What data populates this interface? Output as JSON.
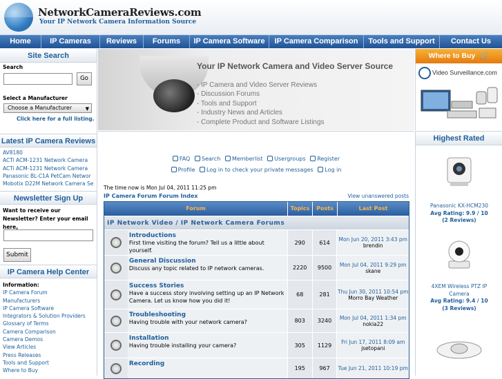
{
  "header": {
    "site_name": "NetworkCameraReviews.com",
    "tagline": "Your IP Network Camera Information Source"
  },
  "nav": {
    "items": [
      "Home",
      "IP Cameras",
      "Reviews",
      "Forums",
      "IP Camera Software",
      "IP Camera Comparison",
      "Tools and Support",
      "Contact Us"
    ]
  },
  "left": {
    "site_search": {
      "heading": "Site Search",
      "search_label": "Search",
      "go_label": "Go",
      "manufacturer_label": "Select a Manufacturer",
      "manufacturer_selected": "Choose a Manufacturer",
      "full_listing_link": "Click here for a full listing."
    },
    "latest_reviews": {
      "heading": "Latest IP Camera Reviews",
      "items": [
        "AV8180",
        "ACTi ACM-1231 Network Camera",
        "ACTi ACM-1231 Network Camera",
        "Panasonic BL-C1A PetCam Networ",
        "Mobotix D22M Network Camera Se"
      ]
    },
    "newsletter": {
      "heading": "Newsletter Sign Up",
      "prompt": "Want to receive our Newsletter? Enter your email here,",
      "submit_label": "Submit"
    },
    "help_center": {
      "heading": "IP Camera Help Center",
      "info_label": "Information:",
      "items": [
        "IP Camera Forum",
        "Manufacturers",
        "IP Camera Software",
        "Integrators & Solution Providers",
        "Glossary of Terms",
        "Camera Comparison",
        "Camera Demos",
        "View Articles",
        "Press Releases",
        "Tools and Support",
        "Where to Buy"
      ]
    }
  },
  "banner": {
    "title": "Your IP Network Camera and Video Server Source",
    "bullets": [
      "- IP Camera and Video Server Reviews",
      "- Discussion Forums",
      "- Tools and Support",
      "- Industry News and Articles",
      "- Complete Product and Software Listings"
    ]
  },
  "ad": {
    "where_to_buy": "Where to Buy",
    "brand": "Video Surveillance.com"
  },
  "forum": {
    "links_row1": [
      "FAQ",
      "Search",
      "Memberlist",
      "Usergroups",
      "Register"
    ],
    "links_row2": [
      "Profile",
      "Log in to check your private messages",
      "Log in"
    ],
    "time_now": "The time now is Mon Jul 04, 2011 11:25 pm",
    "index_link": "IP Camera Forum Forum Index",
    "unanswered_link": "View unanswered posts",
    "columns": [
      "Forum",
      "Topics",
      "Posts",
      "Last Post"
    ],
    "category": "IP Network Video / IP Network Camera Forums",
    "rows": [
      {
        "name": "Introductions",
        "desc": "First time visiting the forum? Tell us a little about yourself.",
        "topics": "290",
        "posts": "614",
        "last_date": "Mon Jun 20, 2011 3:43 pm",
        "last_user": "brendin"
      },
      {
        "name": "General Discussion",
        "desc": "Discuss any topic related to IP network cameras.",
        "topics": "2220",
        "posts": "9500",
        "last_date": "Mon Jul 04, 2011 9:29 pm",
        "last_user": "skane"
      },
      {
        "name": "Success Stories",
        "desc": "Have a success story involving setting up an IP Network Camera. Let us know how you did it!",
        "topics": "68",
        "posts": "281",
        "last_date": "Thu Jun 30, 2011 10:54 pm",
        "last_user": "Morro Bay Weather"
      },
      {
        "name": "Troubleshooting",
        "desc": "Having trouble with your network camera?",
        "topics": "803",
        "posts": "3240",
        "last_date": "Mon Jul 04, 2011 1:34 pm",
        "last_user": "nokia22"
      },
      {
        "name": "Installation",
        "desc": "Having trouble installing your camera?",
        "topics": "305",
        "posts": "1129",
        "last_date": "Fri Jun 17, 2011 8:09 am",
        "last_user": "jsetopani"
      },
      {
        "name": "Recording",
        "desc": "",
        "topics": "195",
        "posts": "967",
        "last_date": "Tue Jun 21, 2011 10:19 pm",
        "last_user": ""
      }
    ]
  },
  "right": {
    "heading": "Highest Rated",
    "items": [
      {
        "name": "Panasonic KX-HCM230",
        "rating": "Avg Rating: 9.9 / 10",
        "reviews": "(2 Reviews)"
      },
      {
        "name": "4XEM Wireless PTZ IP Camera",
        "rating": "Avg Rating: 9.4 / 10",
        "reviews": "(3 Reviews)"
      }
    ]
  }
}
